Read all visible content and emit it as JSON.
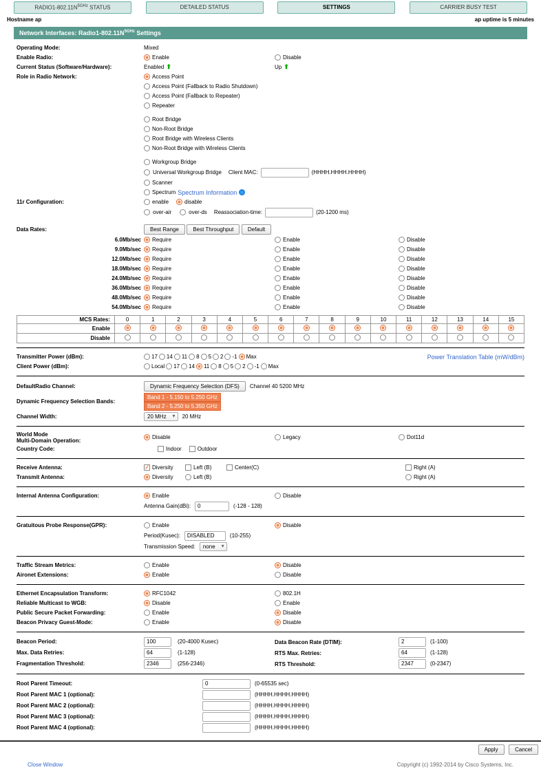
{
  "tabs": [
    "RADIO1-802.11N",
    "DETAILED STATUS",
    "SETTINGS",
    "CARRIER BUSY TEST"
  ],
  "tab0_suffix_sup": "5GHz",
  "tab0_suffix": " STATUS",
  "hostname_label": "Hostname ap",
  "uptime": "ap uptime is 5 minutes",
  "panel_title_prefix": "Network Interfaces: Radio1-802.11N",
  "panel_title_sup": "5GHz",
  "panel_title_suffix": " Settings",
  "operating_mode": {
    "label": "Operating Mode:",
    "value": "Mixed"
  },
  "enable_radio": {
    "label": "Enable Radio:",
    "opt1": "Enable",
    "opt2": "Disable"
  },
  "current_status": {
    "label": "Current Status (Software/Hardware):",
    "v1": "Enabled",
    "v2": "Up"
  },
  "role": {
    "label": "Role in Radio Network:",
    "items": [
      "Access Point",
      "Access Point (Fallback to Radio Shutdown)",
      "Access Point (Fallback to Repeater)",
      "Repeater",
      "Root Bridge",
      "Non-Root Bridge",
      "Root Bridge with Wireless Clients",
      "Non-Root Bridge with Wireless Clients",
      "Workgroup Bridge",
      "Universal Workgroup Bridge",
      "Scanner",
      "Spectrum"
    ],
    "client_mac": "Client MAC:",
    "mac_hint": "(HHHH.HHHH.HHHH)",
    "spectrum_link": "Spectrum Information"
  },
  "r11": {
    "label": "11r Configuration:",
    "enable": "enable",
    "disable": "disable",
    "over_air": "over-air",
    "over_ds": "over-ds",
    "reassoc": "Reassociation-time:",
    "reassoc_hint": "(20-1200 ms)"
  },
  "data_rates": {
    "label": "Data Rates:",
    "best_range": "Best Range",
    "best_throughput": "Best Throughput",
    "default": "Default",
    "rates": [
      "6.0Mb/sec",
      "9.0Mb/sec",
      "12.0Mb/sec",
      "18.0Mb/sec",
      "24.0Mb/sec",
      "36.0Mb/sec",
      "48.0Mb/sec",
      "54.0Mb/sec"
    ],
    "require": "Require",
    "enable": "Enable",
    "disable": "Disable"
  },
  "mcs": {
    "label": "MCS Rates:",
    "cols": [
      "0",
      "1",
      "2",
      "3",
      "4",
      "5",
      "6",
      "7",
      "8",
      "9",
      "10",
      "11",
      "12",
      "13",
      "14",
      "15"
    ],
    "enable": "Enable",
    "disable": "Disable"
  },
  "tx_power": {
    "label": "Transmitter Power (dBm):",
    "opts": [
      "17",
      "14",
      "11",
      "8",
      "5",
      "2",
      "-1",
      "Max"
    ],
    "link": "Power Translation Table (mW/dBm)"
  },
  "client_power": {
    "label": "Client Power (dBm):",
    "opts": [
      "Local",
      "17",
      "14",
      "11",
      "8",
      "5",
      "2",
      "-1",
      "Max"
    ]
  },
  "def_channel": {
    "label": "DefaultRadio Channel:",
    "btn": "Dynamic Frequency Selection (DFS)",
    "info": "Channel 40 5200 MHz"
  },
  "dfs_bands": {
    "label": "Dynamic Frequency Selection Bands:",
    "b1": "Band 1 - 5.150 to 5.250 GHz",
    "b2": "Band 2 - 5.250 to 5.350 GHz"
  },
  "ch_width": {
    "label": "Channel Width:",
    "sel": "20 MHz",
    "txt": "20 MHz"
  },
  "world": {
    "l1": "World Mode",
    "l2": "Multi-Domain Operation:",
    "disable": "Disable",
    "legacy": "Legacy",
    "dot11d": "Dot11d"
  },
  "country": {
    "label": "Country Code:",
    "indoor": "Indoor",
    "outdoor": "Outdoor"
  },
  "rx_ant": {
    "label": "Receive Antenna:",
    "div": "Diversity",
    "left": "Left (B)",
    "center": "Center(C)",
    "right": "Right (A)"
  },
  "tx_ant": {
    "label": "Transmit Antenna:",
    "div": "Diversity",
    "left": "Left (B)",
    "right": "Right (A)"
  },
  "int_ant": {
    "label": "Internal Antenna Configuration:",
    "enable": "Enable",
    "disable": "Disable",
    "gain": "Antenna Gain(dBi):",
    "gain_val": "0",
    "gain_hint": "(-128 - 128)"
  },
  "gpr": {
    "label": "Gratuitous Probe Response(GPR):",
    "enable": "Enable",
    "disable": "Disable",
    "period": "Period(Kusec):",
    "period_val": "DISABLED",
    "period_hint": "(10-255)",
    "speed": "Transmission Speed:",
    "speed_val": "none"
  },
  "tsm": {
    "label": "Traffic Stream Metrics:",
    "enable": "Enable",
    "disable": "Disable"
  },
  "aironet": {
    "label": "Aironet Extensions:",
    "enable": "Enable",
    "disable": "Disable"
  },
  "encap": {
    "label": "Ethernet Encapsulation Transform:",
    "o1": "RFC1042",
    "o2": "802.1H"
  },
  "multicast": {
    "label": "Reliable Multicast to WGB:",
    "disable": "Disable",
    "enable": "Enable"
  },
  "pspf": {
    "label": "Public Secure Packet Forwarding:",
    "enable": "Enable",
    "disable": "Disable"
  },
  "beacon_guest": {
    "label": "Beacon Privacy Guest-Mode:",
    "enable": "Enable",
    "disable": "Disable"
  },
  "beacon_period": {
    "label": "Beacon Period:",
    "val": "100",
    "hint": "(20-4000 Kusec)"
  },
  "dtim": {
    "label": "Data Beacon Rate (DTIM):",
    "val": "2",
    "hint": "(1-100)"
  },
  "max_retries": {
    "label": "Max. Data Retries:",
    "val": "64",
    "hint": "(1-128)"
  },
  "rts_retries": {
    "label": "RTS Max. Retries:",
    "val": "64",
    "hint": "(1-128)"
  },
  "frag": {
    "label": "Fragmentation Threshold:",
    "val": "2346",
    "hint": "(256-2346)"
  },
  "rts_thresh": {
    "label": "RTS Threshold:",
    "val": "2347",
    "hint": "(0-2347)"
  },
  "root_timeout": {
    "label": "Root Parent Timeout:",
    "val": "0",
    "hint": "(0-65535 sec)"
  },
  "root_mac": {
    "l1": "Root Parent MAC 1 (optional):",
    "l2": "Root Parent MAC 2 (optional):",
    "l3": "Root Parent MAC 3 (optional):",
    "l4": "Root Parent MAC 4 (optional):",
    "hint": "(HHHH.HHHH.HHHH)"
  },
  "apply": "Apply",
  "cancel": "Cancel",
  "close": "Close Window",
  "copyright": "Copyright (c) 1992-2014 by Cisco Systems, Inc."
}
